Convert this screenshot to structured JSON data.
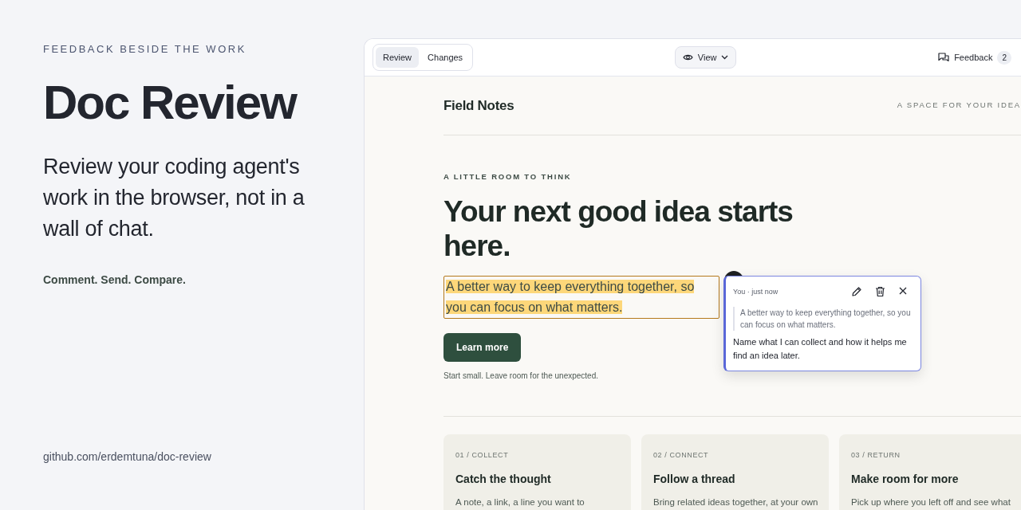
{
  "hero": {
    "eyebrow": "FEEDBACK BESIDE THE WORK",
    "title": "Doc Review",
    "lead": "Review your coding agent's work in the browser, not in a wall of chat.",
    "tagline": "Comment. Send. Compare.",
    "link": "github.com/erdemtuna/doc-review"
  },
  "toolbar": {
    "tabs": [
      {
        "label": "Review",
        "selected": true
      },
      {
        "label": "Changes",
        "selected": false
      }
    ],
    "view_button": "View",
    "feedback": {
      "label": "Feedback",
      "count": "2"
    }
  },
  "document": {
    "site_title": "Field Notes",
    "site_tagline": "A SPACE FOR YOUR IDEA",
    "eyebrow": "A LITTLE ROOM TO THINK",
    "headline": "Your next good idea starts here.",
    "intro": "A better way to keep everything together, so you can focus on what matters.",
    "intro_highlighted": true,
    "button": "Learn more",
    "note": "Start small. Leave room for the unexpected.",
    "cards": [
      {
        "label": "01 / COLLECT",
        "title": "Catch the thought",
        "text": "A note, a link, a line you want to"
      },
      {
        "label": "02 / CONNECT",
        "title": "Follow a thread",
        "text": "Bring related ideas together, at your own"
      },
      {
        "label": "03 / RETURN",
        "title": "Make room for more",
        "text": "Pick up where you left off and see what"
      }
    ]
  },
  "comment": {
    "meta": "You · just now",
    "quote": "A better way to keep everything together, so you can focus on what matters.",
    "body": "Name what I can collect and how it helps me find an idea later."
  }
}
